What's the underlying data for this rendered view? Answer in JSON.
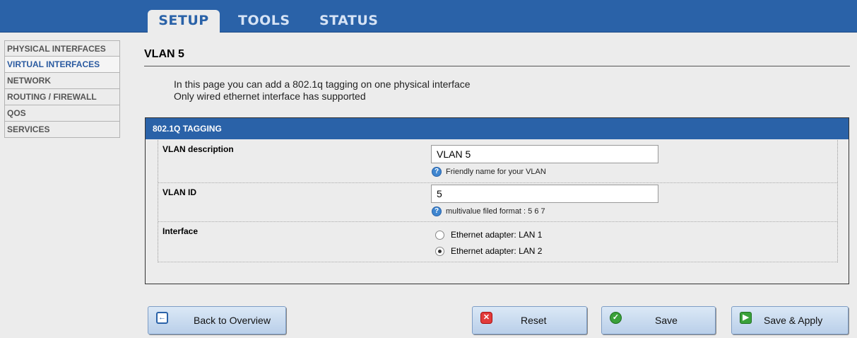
{
  "tabs": [
    {
      "label": "SETUP",
      "active": true
    },
    {
      "label": "TOOLS",
      "active": false
    },
    {
      "label": "STATUS",
      "active": false
    }
  ],
  "sidebar": {
    "items": [
      {
        "label": "PHYSICAL INTERFACES",
        "active": false
      },
      {
        "label": "VIRTUAL INTERFACES",
        "active": true
      },
      {
        "label": "NETWORK",
        "active": false
      },
      {
        "label": "ROUTING / FIREWALL",
        "active": false
      },
      {
        "label": "QOS",
        "active": false
      },
      {
        "label": "SERVICES",
        "active": false
      }
    ]
  },
  "page": {
    "title": "VLAN 5",
    "intro_line1": "In this page you can add a 802.1q tagging on one physical interface",
    "intro_line2": "Only wired ethernet interface has supported"
  },
  "panel": {
    "header": "802.1Q TAGGING",
    "description": {
      "label": "VLAN description",
      "value": "VLAN 5",
      "hint": "Friendly name for your VLAN"
    },
    "vlan_id": {
      "label": "VLAN ID",
      "value": "5",
      "hint": "multivalue filed format : 5 6 7"
    },
    "interface": {
      "label": "Interface",
      "options": [
        {
          "label": "Ethernet adapter: LAN 1",
          "checked": false
        },
        {
          "label": "Ethernet adapter: LAN 2",
          "checked": true
        }
      ]
    }
  },
  "buttons": {
    "back": "Back to Overview",
    "reset": "Reset",
    "save": "Save",
    "save_apply": "Save & Apply"
  },
  "icons": {
    "help": "help-icon",
    "back": "back-arrow-icon",
    "reset": "reset-x-icon",
    "save": "check-icon",
    "save_apply": "play-icon"
  },
  "colors": {
    "accent": "#2a62a8",
    "background": "#ececec"
  }
}
